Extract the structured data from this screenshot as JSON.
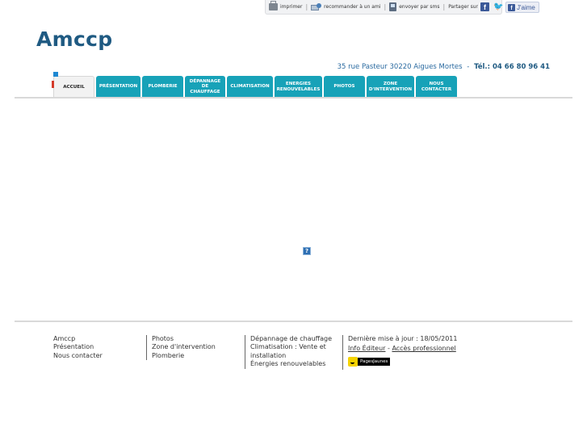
{
  "toolbar": {
    "print_label": "imprimer",
    "recommend_label": "recommander à un ami",
    "sms_label": "envoyer par sms",
    "share_label": "Partager sur",
    "facebook_glyph": "f",
    "twitter_glyph": "🐦"
  },
  "like": {
    "glyph": "f",
    "label": "J'aime"
  },
  "site": {
    "title": "Amccp"
  },
  "contact": {
    "address": "35 rue Pasteur 30220 Aigues Mortes",
    "separator": "-",
    "tel": "Tél.: 04 66 80 96 41"
  },
  "nav": {
    "tabs": [
      {
        "label": "Accueil"
      },
      {
        "label": "Présentation"
      },
      {
        "label": "Plomberie"
      },
      {
        "label": "Dépannage de chauffage"
      },
      {
        "label": "Climatisation"
      },
      {
        "label": "Energies renouvelables"
      },
      {
        "label": "Photos"
      },
      {
        "label": "Zone d'intervention"
      },
      {
        "label": "Nous contacter"
      }
    ]
  },
  "content": {
    "placeholder_glyph": "?"
  },
  "footer": {
    "col1": [
      "Amccp",
      "Présentation",
      "Nous contacter"
    ],
    "col2": [
      "Photos",
      "Zone d'intervention",
      "Plomberie"
    ],
    "col3": [
      "Dépannage de chauffage",
      "Climatisation : Vente et",
      "installation",
      "Énergies renouvelables"
    ],
    "col4": {
      "updated": "Dernière mise à jour : 18/05/2011",
      "info_editor": "Info Éditeur",
      "dash": "-",
      "pro_access": "Accès professionnel",
      "pages_jaunes": "PagesJaunes"
    }
  },
  "colors": {
    "accent": "#17a2b8",
    "title": "#1f5a82",
    "link": "#2a6aa0"
  }
}
